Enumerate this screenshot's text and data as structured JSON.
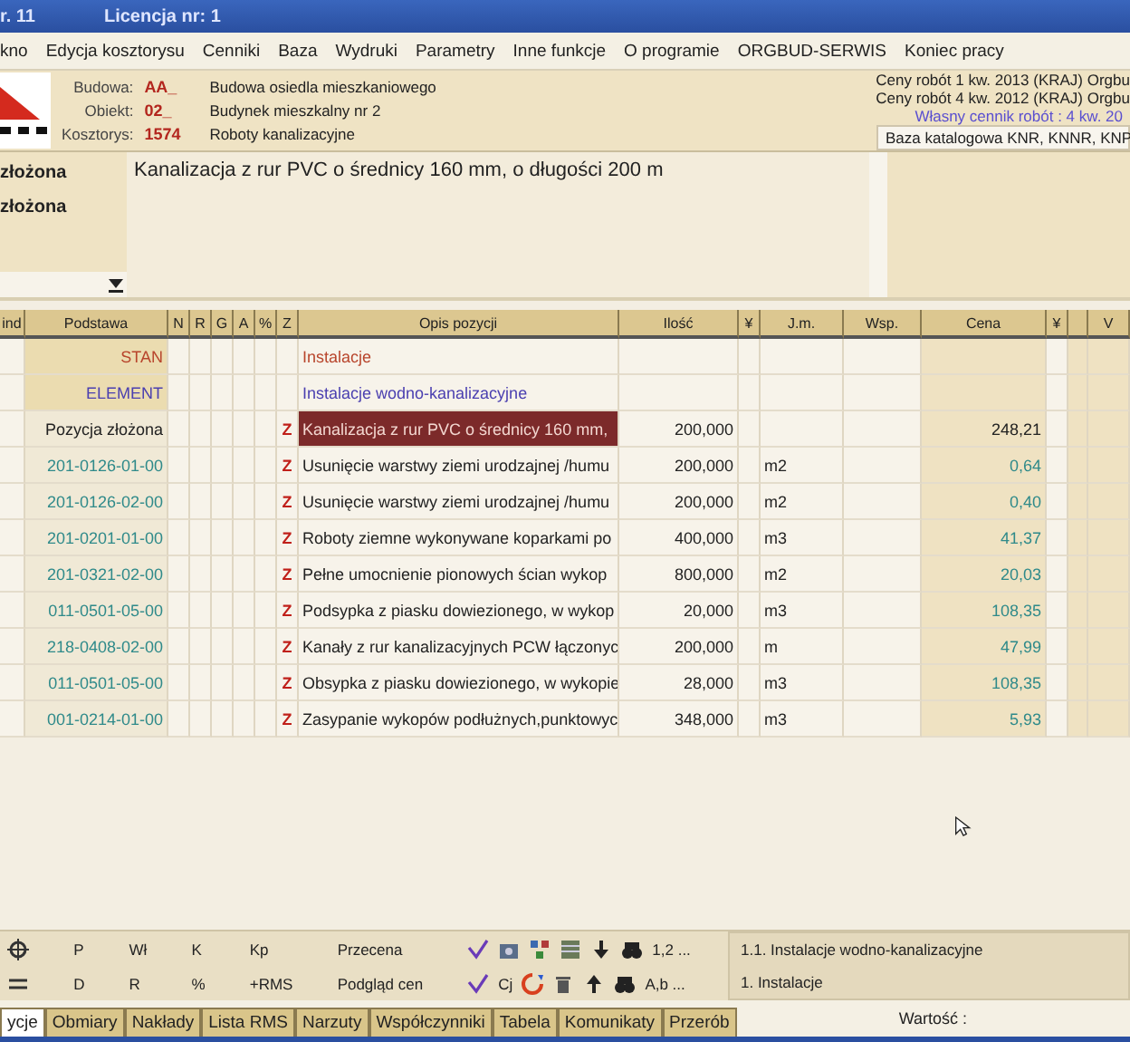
{
  "window": {
    "title": "r. 11",
    "license": "Licencja nr: 1"
  },
  "menu": [
    "kno",
    "Edycja kosztorysu",
    "Cenniki",
    "Baza",
    "Wydruki",
    "Parametry",
    "Inne funkcje",
    "O programie",
    "ORGBUD-SERWIS",
    "Koniec pracy"
  ],
  "header": {
    "fields": [
      {
        "label": "Budowa:",
        "code": "AA_",
        "name": "Budowa osiedla mieszkaniowego"
      },
      {
        "label": "Obiekt:",
        "code": "02_",
        "name": "Budynek mieszkalny nr 2"
      },
      {
        "label": "Kosztorys:",
        "code": "1574",
        "name": "Roboty kanalizacyjne"
      }
    ],
    "price_lists": [
      "Ceny robót 1 kw. 2013 (KRAJ) Orgbu",
      "Ceny robót 4 kw. 2012 (KRAJ) Orgbu"
    ],
    "own_price_list": "Własny cennik robót : 4 kw. 20",
    "catalog_base": "Baza katalogowa KNR, KNNR, KNP"
  },
  "side_panel": {
    "items": [
      "złożona",
      "złożona"
    ]
  },
  "description": "Kanalizacja z rur PVC o średnicy 160 mm, o długości 200 m",
  "table": {
    "columns": [
      "ind",
      "Podstawa",
      "N",
      "R",
      "G",
      "A",
      "%",
      "Z",
      "Opis pozycji",
      "Ilość",
      "¥",
      "J.m.",
      "Wsp.",
      "Cena",
      "¥",
      "",
      "V"
    ],
    "rows": [
      {
        "kind": "stan",
        "podstawa": "STAN",
        "z": "",
        "opis": "Instalacje",
        "ilosc": "",
        "jm": "",
        "cena": "",
        "selected": false
      },
      {
        "kind": "element",
        "podstawa": "ELEMENT",
        "z": "",
        "opis": "Instalacje wodno-kanalizacyjne",
        "ilosc": "",
        "jm": "",
        "cena": "",
        "selected": false
      },
      {
        "kind": "zlozona",
        "podstawa": "Pozycja złożona",
        "z": "Z",
        "opis": "Kanalizacja z rur PVC o średnicy 160 mm,",
        "ilosc": "200,000",
        "jm": "",
        "cena": "248,21",
        "selected": true
      },
      {
        "kind": "pozycja",
        "podstawa": "201-0126-01-00",
        "z": "Z",
        "opis": "Usunięcie warstwy ziemi urodzajnej /humu",
        "ilosc": "200,000",
        "jm": "m2",
        "cena": "0,64",
        "selected": false
      },
      {
        "kind": "pozycja",
        "podstawa": "201-0126-02-00",
        "z": "Z",
        "opis": "Usunięcie warstwy ziemi urodzajnej /humu",
        "ilosc": "200,000",
        "jm": "m2",
        "cena": "0,40",
        "selected": false
      },
      {
        "kind": "pozycja",
        "podstawa": "201-0201-01-00",
        "z": "Z",
        "opis": "Roboty ziemne wykonywane koparkami po",
        "ilosc": "400,000",
        "jm": "m3",
        "cena": "41,37",
        "selected": false
      },
      {
        "kind": "pozycja",
        "podstawa": "201-0321-02-00",
        "z": "Z",
        "opis": "Pełne umocnienie pionowych ścian wykop",
        "ilosc": "800,000",
        "jm": "m2",
        "cena": "20,03",
        "selected": false
      },
      {
        "kind": "pozycja",
        "podstawa": "011-0501-05-00",
        "z": "Z",
        "opis": "Podsypka z piasku dowiezionego, w wykop",
        "ilosc": "20,000",
        "jm": "m3",
        "cena": "108,35",
        "selected": false
      },
      {
        "kind": "pozycja",
        "podstawa": "218-0408-02-00",
        "z": "Z",
        "opis": "Kanały z rur kanalizacyjnych PCW łączonyc",
        "ilosc": "200,000",
        "jm": "m",
        "cena": "47,99",
        "selected": false
      },
      {
        "kind": "pozycja",
        "podstawa": "011-0501-05-00",
        "z": "Z",
        "opis": "Obsypka z piasku dowiezionego, w wykopie",
        "ilosc": "28,000",
        "jm": "m3",
        "cena": "108,35",
        "selected": false
      },
      {
        "kind": "pozycja",
        "podstawa": "001-0214-01-00",
        "z": "Z",
        "opis": "Zasypanie wykopów podłużnych,punktowyc",
        "ilosc": "348,000",
        "jm": "m3",
        "cena": "5,93",
        "selected": false
      }
    ]
  },
  "toolbar": {
    "row1_keys": [
      "P",
      "Wł",
      "K",
      "Kp"
    ],
    "row2_keys": [
      "D",
      "R",
      "%",
      "+RMS"
    ],
    "przecena": "Przecena",
    "podglad": "Podgląd cen",
    "cj": "Cj",
    "sort_numeric": "1,2 ...",
    "sort_alpha": "A,b ..."
  },
  "path_panel": [
    "1.1. Instalacje wodno-kanalizacyjne",
    "1.  Instalacje"
  ],
  "tabs": [
    {
      "label": "ycje",
      "selected": true
    },
    {
      "label": "Obmiary",
      "selected": false
    },
    {
      "label": "Nakłady",
      "selected": false
    },
    {
      "label": "Lista RMS",
      "selected": false
    },
    {
      "label": "Narzuty",
      "selected": false
    },
    {
      "label": "Współczynniki",
      "selected": false
    },
    {
      "label": "Tabela",
      "selected": false
    },
    {
      "label": "Komunikaty",
      "selected": false
    },
    {
      "label": "Przerób",
      "selected": false
    }
  ],
  "value_label": "Wartość :"
}
